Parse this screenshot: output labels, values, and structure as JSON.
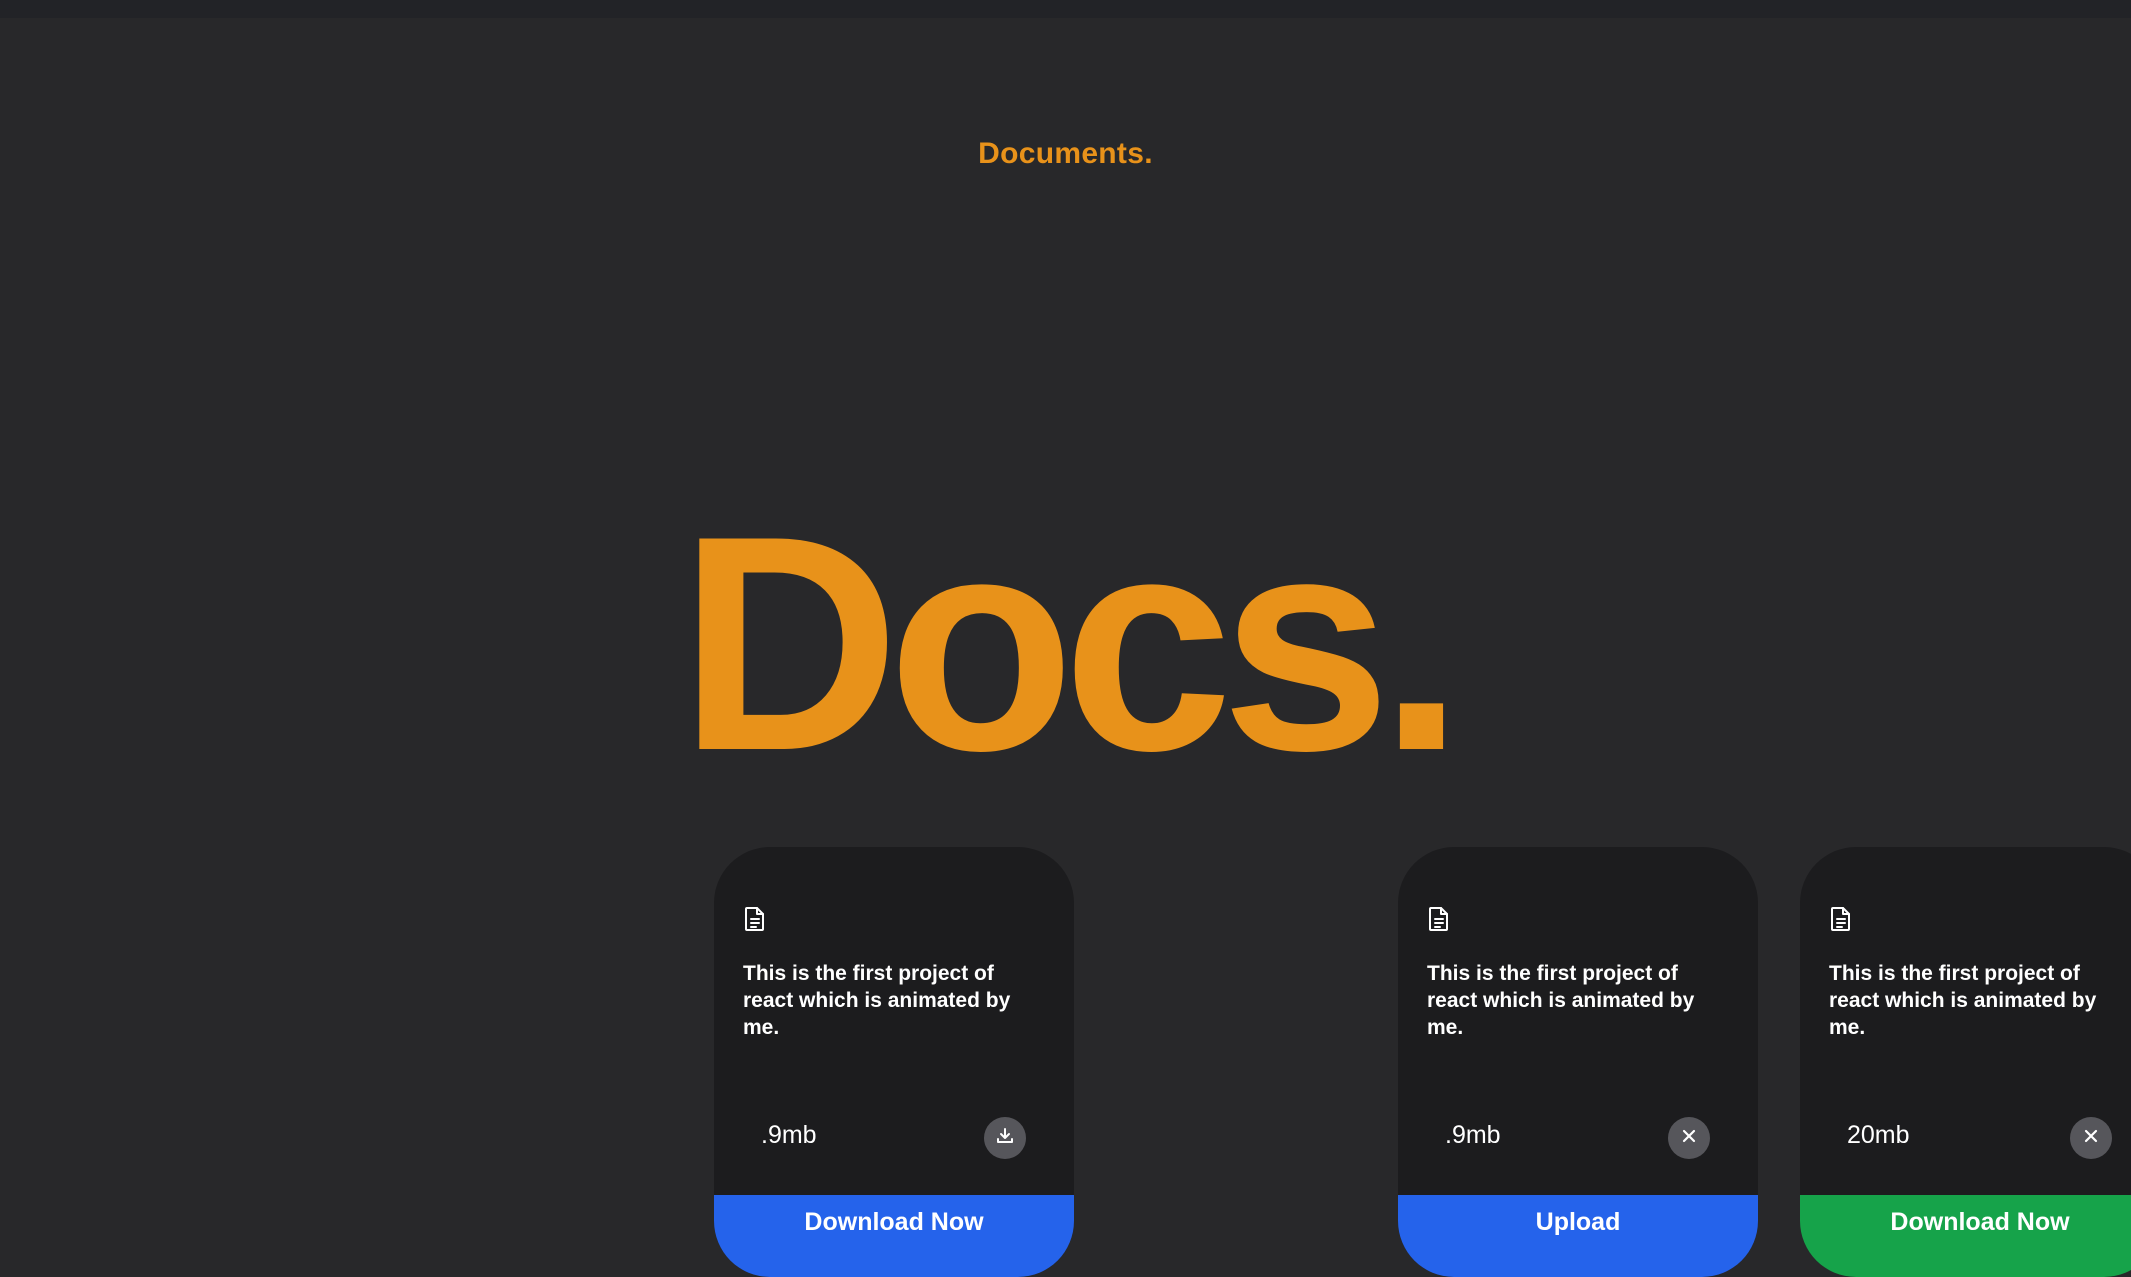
{
  "page": {
    "small_heading": "Documents.",
    "big_heading": "Docs."
  },
  "cards": [
    {
      "description": "This is the first project of react which is animated by me.",
      "size": ".9mb",
      "action_icon": "download-icon",
      "footer_label": "Download Now",
      "footer_color": "#2563eb"
    },
    {
      "description": "This is the first project of react which is animated by me.",
      "size": ".9mb",
      "action_icon": "close-icon",
      "footer_label": "Upload",
      "footer_color": "#2563eb"
    },
    {
      "description": "This is the first project of react which is animated by me.",
      "size": "20mb",
      "action_icon": "close-icon",
      "footer_label": "Download Now",
      "footer_color": "#16a34a"
    }
  ],
  "colors": {
    "background": "#28282a",
    "accent": "#e8921a",
    "card": "#1c1c1e",
    "action_button": "#56565b"
  }
}
